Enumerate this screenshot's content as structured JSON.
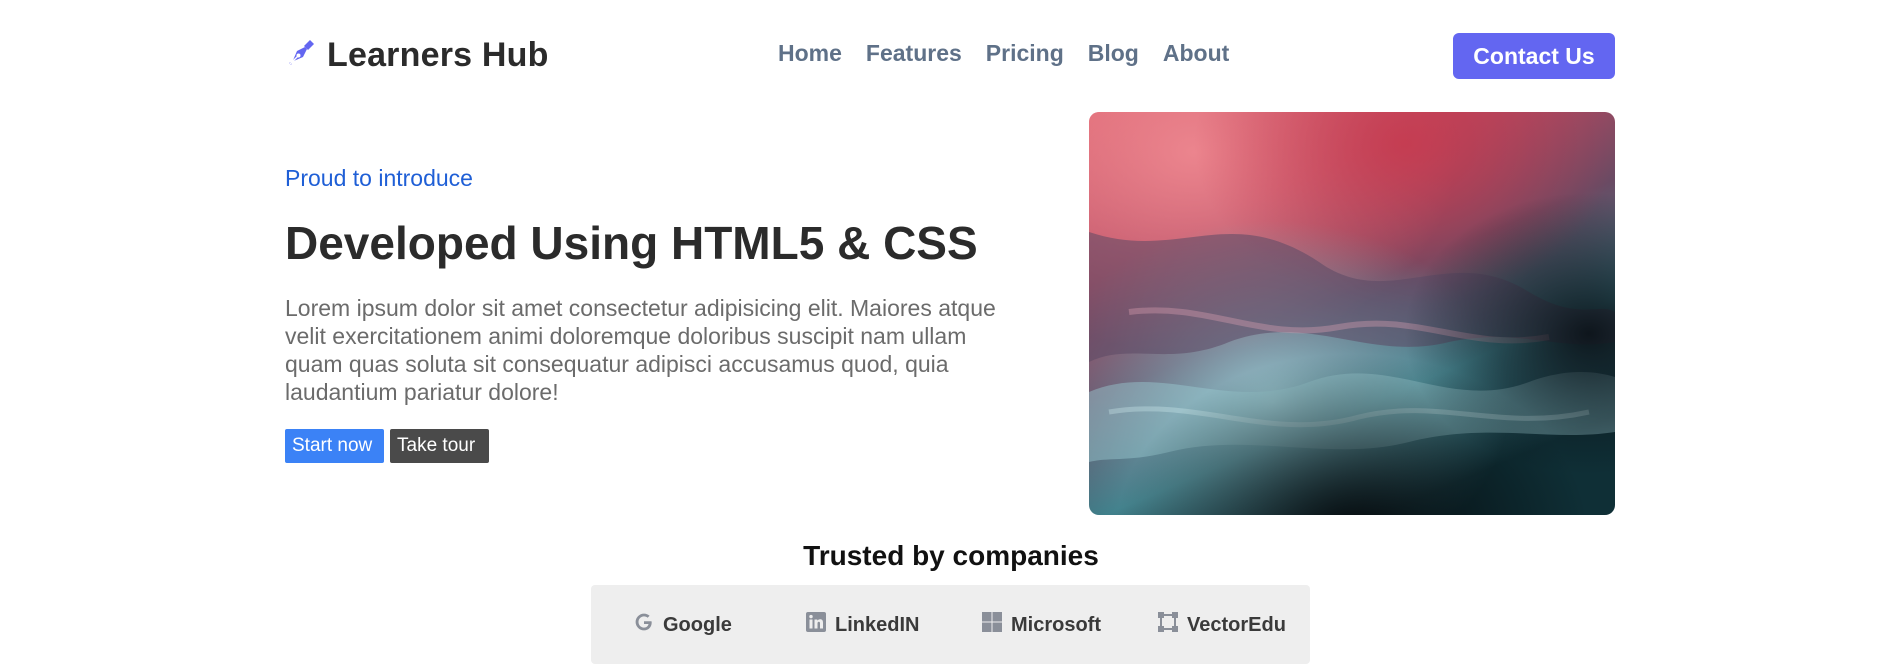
{
  "header": {
    "brand_icon": "pen-nib-icon",
    "brand_name": "Learners Hub",
    "nav": [
      "Home",
      "Features",
      "Pricing",
      "Blog",
      "About"
    ],
    "contact_label": "Contact Us"
  },
  "hero": {
    "eyebrow": "Proud to introduce",
    "headline": "Developed Using HTML5 & CSS",
    "lead": "Lorem ipsum dolor sit amet consectetur adipisicing elit. Maiores atque velit exercitationem animi doloremque doloribus suscipit nam ullam quam quas soluta sit consequatur adipisci accusamus quod, quia laudantium pariatur dolore!",
    "primary_button": "Start now",
    "secondary_button": "Take tour"
  },
  "trusted": {
    "title": "Trusted by companies",
    "companies": [
      {
        "name": "Google",
        "icon": "google-icon"
      },
      {
        "name": "LinkedIN",
        "icon": "linkedin-icon"
      },
      {
        "name": "Microsoft",
        "icon": "microsoft-icon"
      },
      {
        "name": "VectorEdu",
        "icon": "vector-icon"
      }
    ]
  },
  "colors": {
    "accent": "#6366f1",
    "link": "#1f5fd6",
    "nav": "#5f7188",
    "primary_button": "#3b82f6",
    "dark_button": "#4a4a4a"
  }
}
